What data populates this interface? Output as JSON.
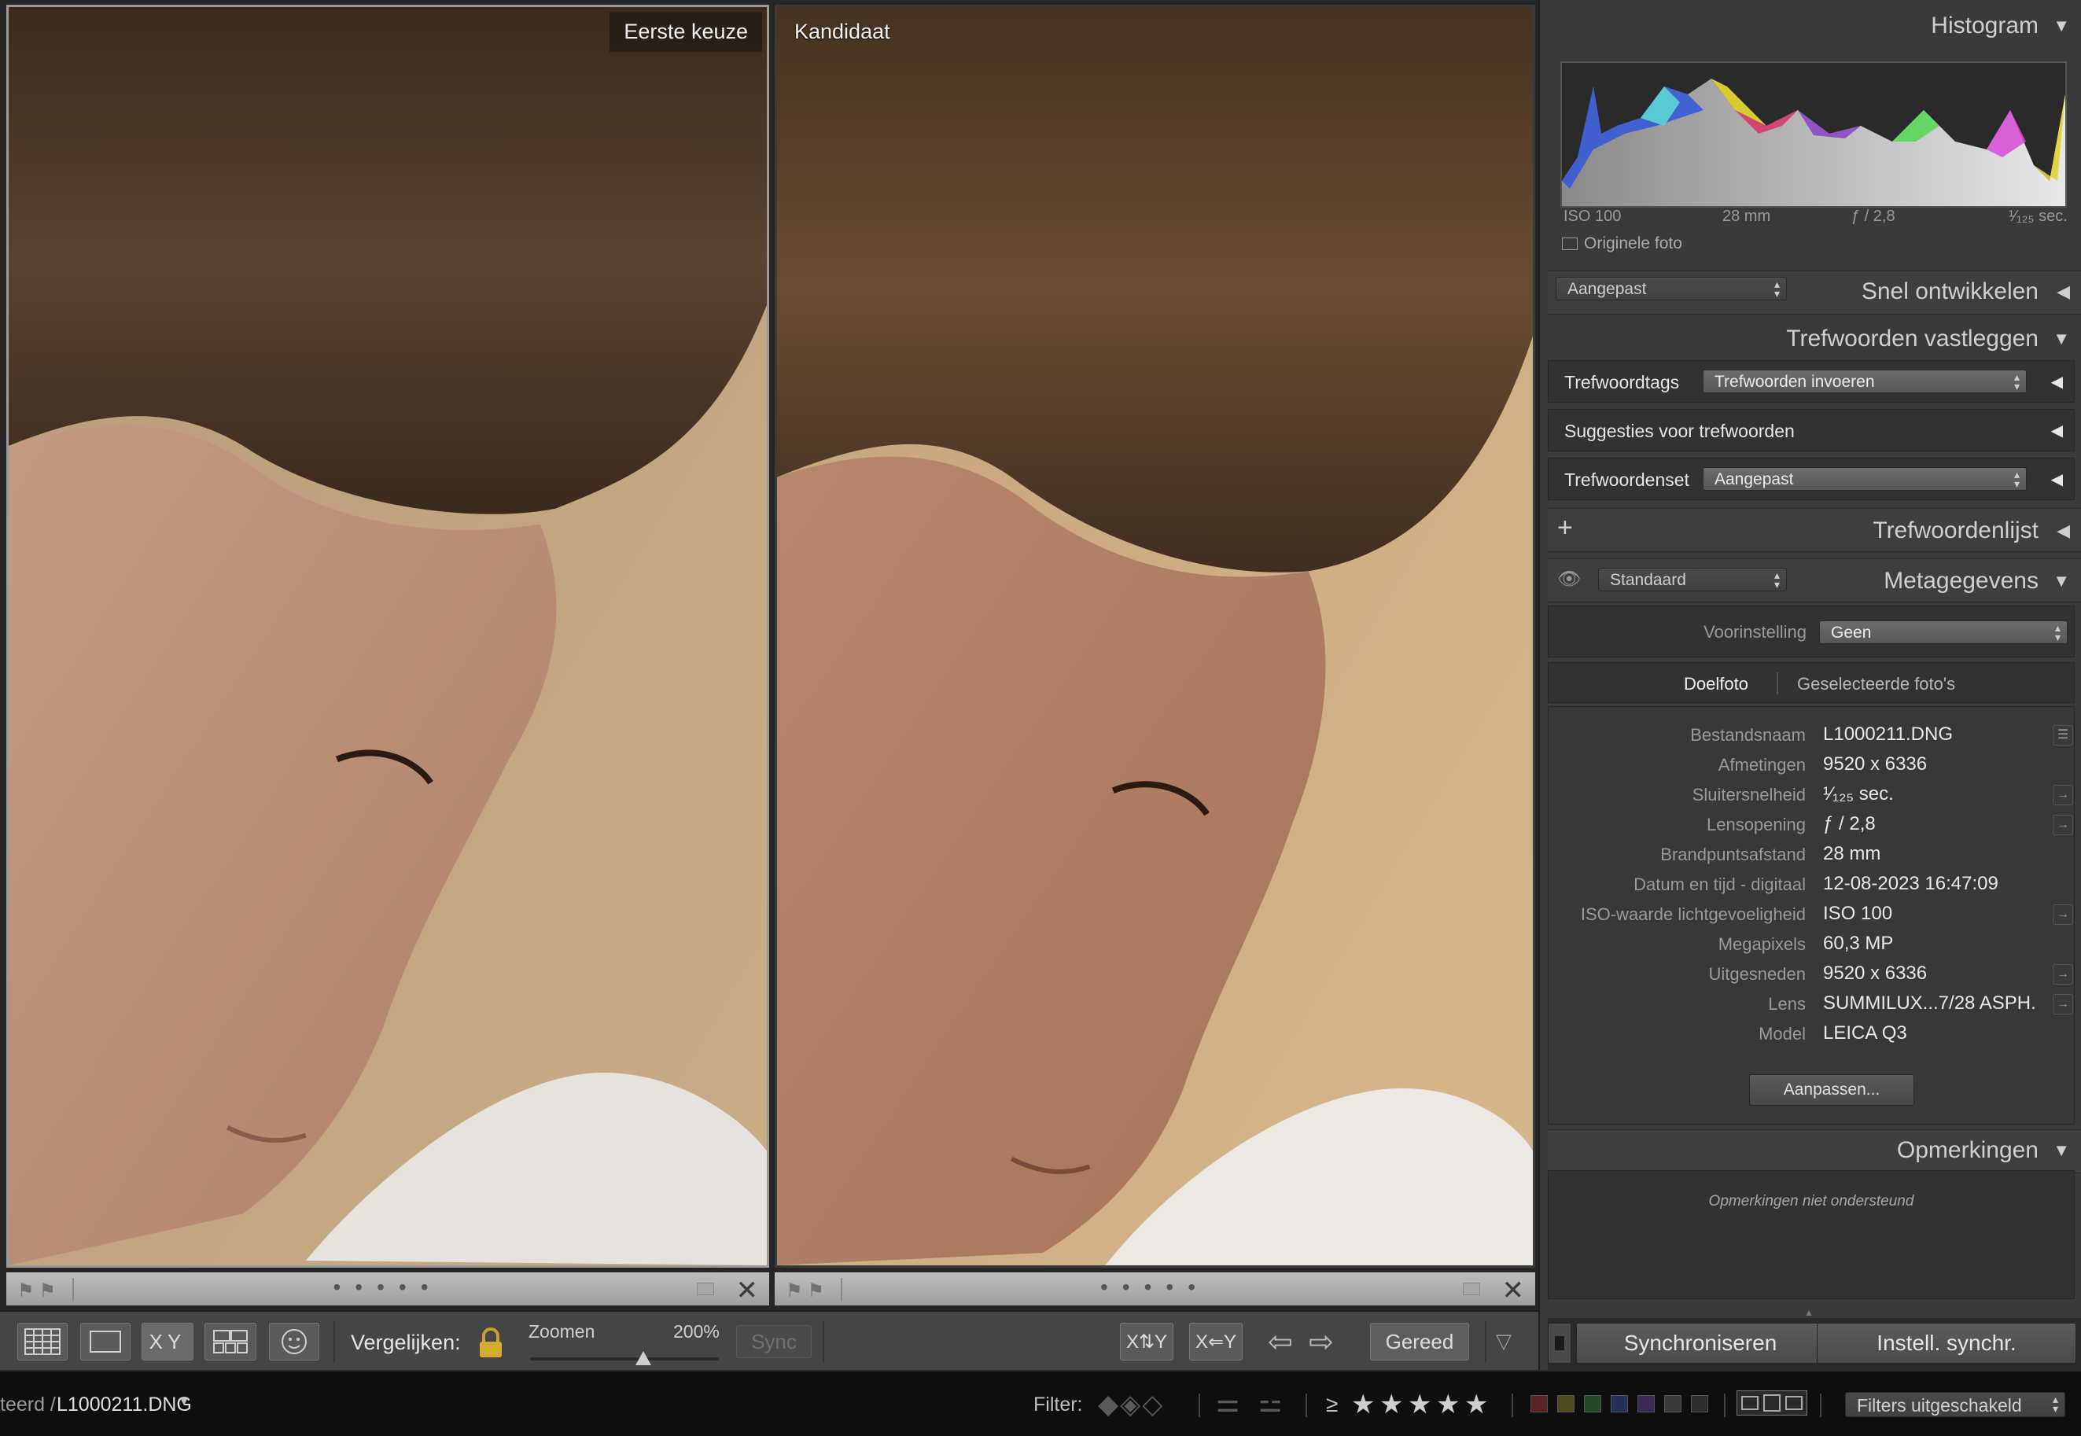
{
  "compare": {
    "left_label": "Eerste keuze",
    "right_label": "Kandidaat"
  },
  "toolbar": {
    "compare_label": "Vergelijken:",
    "zoom_label": "Zoomen",
    "zoom_value": "200%",
    "zoom_level_percent": 200,
    "sync_label": "Sync",
    "done_label": "Gereed",
    "xy_label": "XY"
  },
  "histogram": {
    "title": "Histogram",
    "iso": "ISO 100",
    "focal": "28 mm",
    "aperture": "ƒ / 2,8",
    "shutter": "¹⁄₁₂₅ sec.",
    "original_label": "Originele foto"
  },
  "quick_develop": {
    "title": "Snel ontwikkelen",
    "preset": "Aangepast"
  },
  "keywording": {
    "title": "Trefwoorden vastleggen",
    "tags_label": "Trefwoordtags",
    "tags_value": "Trefwoorden invoeren",
    "suggestions_label": "Suggesties voor trefwoorden",
    "set_label": "Trefwoordenset",
    "set_value": "Aangepast"
  },
  "keyword_list": {
    "title": "Trefwoordenlijst",
    "add": "+"
  },
  "metadata": {
    "title": "Metagegevens",
    "view": "Standaard",
    "preset_label": "Voorinstelling",
    "preset_value": "Geen",
    "tab_target": "Doelfoto",
    "tab_selected": "Geselecteerde foto's",
    "fields": [
      {
        "key": "Bestandsnaam",
        "value": "L1000211.DNG"
      },
      {
        "key": "Afmetingen",
        "value": "9520 x 6336"
      },
      {
        "key": "Sluitersnelheid",
        "value": "¹⁄₁₂₅ sec."
      },
      {
        "key": "Lensopening",
        "value": "ƒ / 2,8"
      },
      {
        "key": "Brandpuntsafstand",
        "value": "28 mm"
      },
      {
        "key": "Datum en tijd - digitaal",
        "value": "12-08-2023 16:47:09"
      },
      {
        "key": "ISO-waarde lichtgevoeligheid",
        "value": "ISO 100"
      },
      {
        "key": "Megapixels",
        "value": "60,3 MP"
      },
      {
        "key": "Uitgesneden",
        "value": "9520 x 6336"
      },
      {
        "key": "Lens",
        "value": "SUMMILUX...7/28 ASPH."
      },
      {
        "key": "Model",
        "value": "LEICA Q3"
      }
    ],
    "customize_button": "Aanpassen..."
  },
  "comments": {
    "title": "Opmerkingen",
    "placeholder": "Opmerkingen niet ondersteund"
  },
  "sync": {
    "sync_button": "Synchroniseren",
    "settings_button": "Instell. synchr."
  },
  "bottom_bar": {
    "path_prefix": "teerd /",
    "filename": "L1000211.DNG",
    "filter_label": "Filter:",
    "filter_state": "Filters uitgeschakeld",
    "rating_op": "≥"
  },
  "colors": {
    "label_red": "#5a2424",
    "label_yellow": "#4e4a1e",
    "label_green": "#234a28",
    "label_blue": "#23305a",
    "label_purple": "#3a2a55",
    "label_gray1": "#3a3a3a",
    "label_gray2": "#2e2e2e"
  }
}
